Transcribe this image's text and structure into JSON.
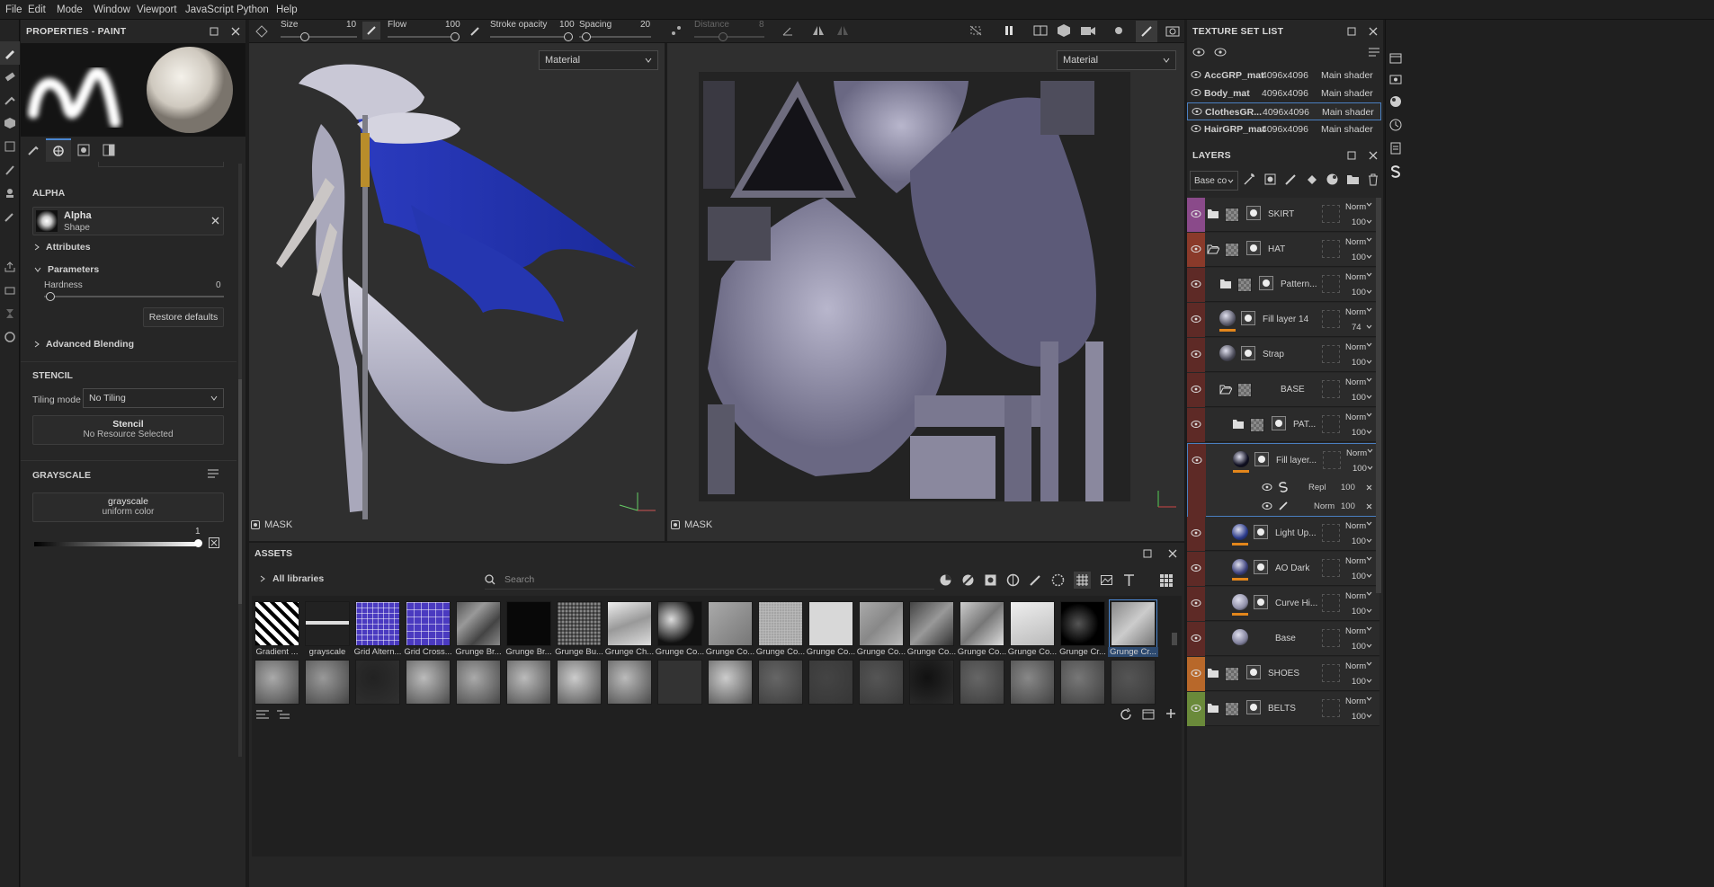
{
  "menu": [
    "File",
    "Edit",
    "Mode",
    "Window",
    "Viewport",
    "JavaScript",
    "Python",
    "Help"
  ],
  "properties": {
    "title": "PROPERTIES - PAINT",
    "alpha_section": "ALPHA",
    "alpha_name": "Alpha",
    "alpha_sub": "Shape",
    "attributes": "Attributes",
    "parameters": "Parameters",
    "hardness_label": "Hardness",
    "hardness_value": "0",
    "restore_defaults": "Restore defaults",
    "advanced_blending": "Advanced Blending",
    "stencil_section": "STENCIL",
    "tiling_label": "Tiling mode",
    "tiling_value": "No Tiling",
    "stencil_btn": "Stencil",
    "stencil_sub": "No Resource Selected",
    "grayscale_section": "GRAYSCALE",
    "grayscale_name": "grayscale",
    "grayscale_sub": "uniform color",
    "grayscale_value": "1"
  },
  "toolbar": {
    "size_label": "Size",
    "size_value": "10",
    "flow_label": "Flow",
    "flow_value": "100",
    "stroke_label": "Stroke opacity",
    "stroke_value": "100",
    "spacing_label": "Spacing",
    "spacing_value": "20",
    "distance_label": "Distance",
    "distance_value": "8"
  },
  "viewport3d": {
    "material_select": "Material",
    "mask_label": "MASK"
  },
  "viewport2d": {
    "material_select": "Material",
    "mask_label": "MASK"
  },
  "assets": {
    "title": "ASSETS",
    "libraries": "All libraries",
    "search_placeholder": "Search",
    "row1": [
      "Gradient ...",
      "grayscale",
      "Grid Altern...",
      "Grid Cross...",
      "Grunge Br...",
      "Grunge Br...",
      "Grunge Bu...",
      "Grunge Ch...",
      "Grunge Co...",
      "Grunge Co...",
      "Grunge Co...",
      "Grunge Co...",
      "Grunge Co...",
      "Grunge Co...",
      "Grunge Co...",
      "Grunge Co...",
      "Grunge Cr...",
      "Grunge Cr..."
    ]
  },
  "texture_set_list": {
    "title": "TEXTURE SET LIST",
    "rows": [
      {
        "name": "AccGRP_mat",
        "res": "4096x4096",
        "shader": "Main shader"
      },
      {
        "name": "Body_mat",
        "res": "4096x4096",
        "shader": "Main shader"
      },
      {
        "name": "ClothesGR...",
        "res": "4096x4096",
        "shader": "Main shader"
      },
      {
        "name": "HairGRP_mat",
        "res": "4096x4096",
        "shader": "Main shader"
      }
    ]
  },
  "layers": {
    "title": "LAYERS",
    "channel_select": "Base co",
    "items": [
      {
        "name": "SKIRT",
        "blend": "Norm",
        "opacity": "100",
        "color": "#8a4a8a"
      },
      {
        "name": "HAT",
        "blend": "Norm",
        "opacity": "100",
        "color": "#8a3a2a"
      },
      {
        "name": "Pattern...",
        "blend": "Norm",
        "opacity": "100",
        "color": "#5e2a26"
      },
      {
        "name": "Fill layer 14",
        "blend": "Norm",
        "opacity": "74",
        "color": "#5e2a26"
      },
      {
        "name": "Strap",
        "blend": "Norm",
        "opacity": "100",
        "color": "#5e2a26"
      },
      {
        "name": "BASE",
        "blend": "Norm",
        "opacity": "100",
        "color": "#5e2a26"
      },
      {
        "name": "PAT...",
        "blend": "Norm",
        "opacity": "100",
        "color": "#5e2a26"
      },
      {
        "name": "Fill layer...",
        "blend": "Norm",
        "opacity": "100",
        "color": "#5e2a26"
      },
      {
        "name": "Light Up...",
        "blend": "Norm",
        "opacity": "100",
        "color": "#5e2a26"
      },
      {
        "name": "AO Dark",
        "blend": "Norm",
        "opacity": "100",
        "color": "#5e2a26"
      },
      {
        "name": "Curve Hi...",
        "blend": "Norm",
        "opacity": "100",
        "color": "#5e2a26"
      },
      {
        "name": "Base",
        "blend": "Norm",
        "opacity": "100",
        "color": "#5e2a26"
      },
      {
        "name": "SHOES",
        "blend": "Norm",
        "opacity": "100",
        "color": "#b8682a"
      },
      {
        "name": "BELTS",
        "blend": "Norm",
        "opacity": "100",
        "color": "#6a8a3a"
      }
    ],
    "sub_effects": [
      {
        "blend": "Repl",
        "opacity": "100"
      },
      {
        "blend": "Norm",
        "opacity": "100"
      }
    ]
  }
}
